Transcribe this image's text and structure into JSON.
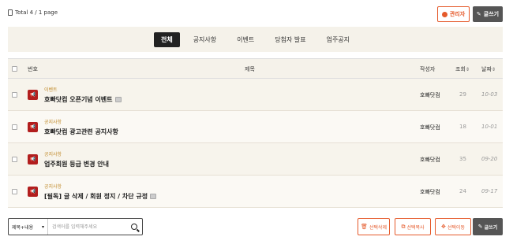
{
  "header": {
    "total_text": "Total 4 / 1 page",
    "admin_label": "관리자",
    "write_label": "글쓰기"
  },
  "tabs": [
    {
      "label": "전체",
      "active": true
    },
    {
      "label": "공지사항",
      "active": false
    },
    {
      "label": "이벤트",
      "active": false
    },
    {
      "label": "당첨자 발표",
      "active": false
    },
    {
      "label": "업주공지",
      "active": false
    }
  ],
  "table": {
    "columns": {
      "number": "번호",
      "title": "제목",
      "author": "작성자",
      "views": "조회",
      "date": "날짜"
    },
    "rows": [
      {
        "category": "이벤트",
        "title": "호빠닷컴 오픈기념 이벤트",
        "has_attachment": true,
        "author": "호빠닷컴",
        "views": "29",
        "date": "10-03"
      },
      {
        "category": "공지사항",
        "title": "호빠닷컴 광고관련 공지사항",
        "has_attachment": false,
        "author": "호빠닷컴",
        "views": "18",
        "date": "10-01"
      },
      {
        "category": "공지사항",
        "title": "업주회원 등급 변경 안내",
        "has_attachment": false,
        "author": "호빠닷컴",
        "views": "35",
        "date": "09-20"
      },
      {
        "category": "공지사항",
        "title": "[필독] 글 삭제 / 회원 정지 / 차단 규정",
        "has_attachment": true,
        "author": "호빠닷컴",
        "views": "24",
        "date": "09-17"
      }
    ]
  },
  "footer": {
    "search_select": "제목+내용",
    "search_placeholder": "검색어를 입력해주세요",
    "delete_label": "선택삭제",
    "copy_label": "선택복사",
    "move_label": "선택이동",
    "write_label": "글쓰기"
  },
  "colors": {
    "accent": "#e55a2b",
    "badge": "#b21e1e",
    "category": "#c08a2a",
    "header_bg": "#f5f2ea"
  }
}
